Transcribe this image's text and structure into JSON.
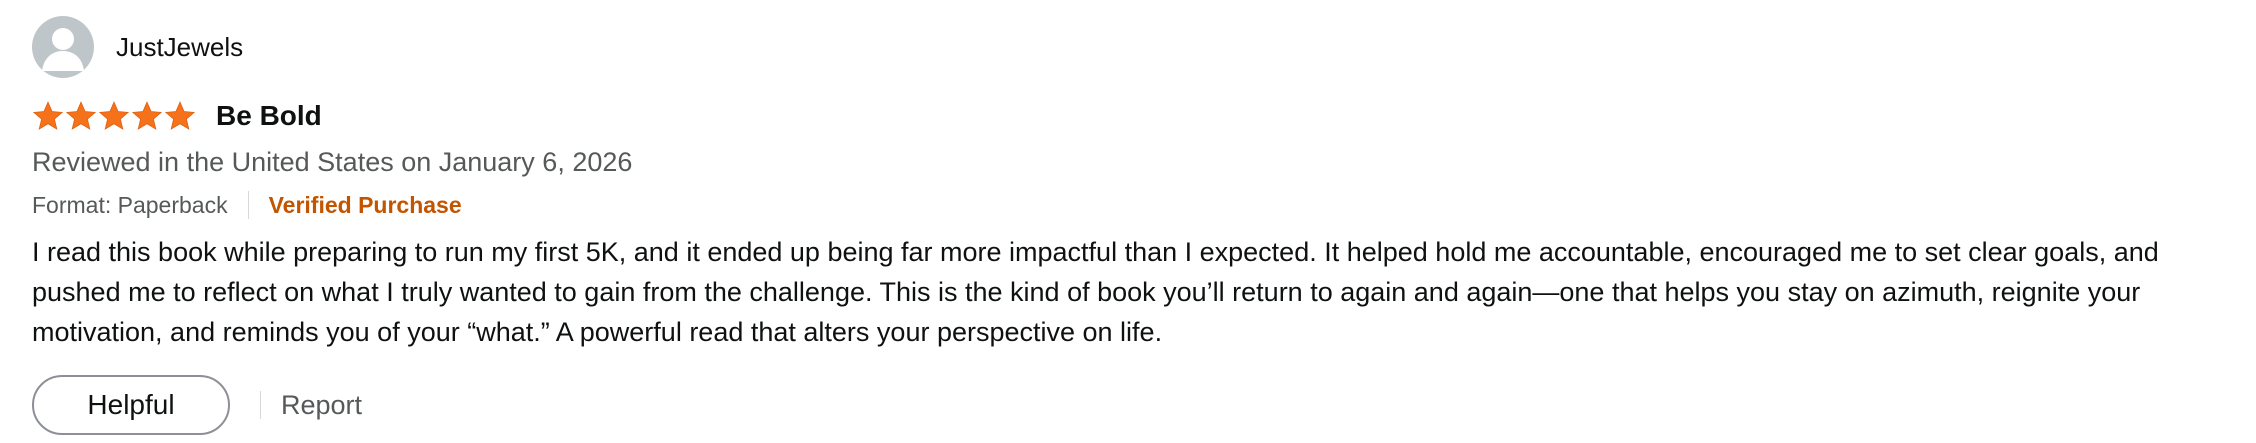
{
  "review": {
    "profile": {
      "name": "JustJewels",
      "avatar_icon": "default-avatar-icon"
    },
    "rating": {
      "value": 5,
      "max": 5,
      "star_color": "#f5711a",
      "icon": "star-icon"
    },
    "title": "Be Bold",
    "date_text": "Reviewed in the United States on January 6, 2026",
    "format_text": "Format: Paperback",
    "verified_text": "Verified Purchase",
    "body": "I read this book while preparing to run my first 5K, and it ended up being far more impactful than I expected. It helped hold me accountable, encouraged me to set clear goals, and pushed me to reflect on what I truly wanted to gain from the challenge. This is the kind of book you’ll return to again and again—one that helps you stay on azimuth, reignite your motivation, and reminds you of your “what.” A powerful read that alters your perspective on life.",
    "actions": {
      "helpful_label": "Helpful",
      "report_label": "Report"
    }
  },
  "colors": {
    "verified": "#c45500",
    "secondary_text": "#565959",
    "primary_text": "#0f1111"
  }
}
